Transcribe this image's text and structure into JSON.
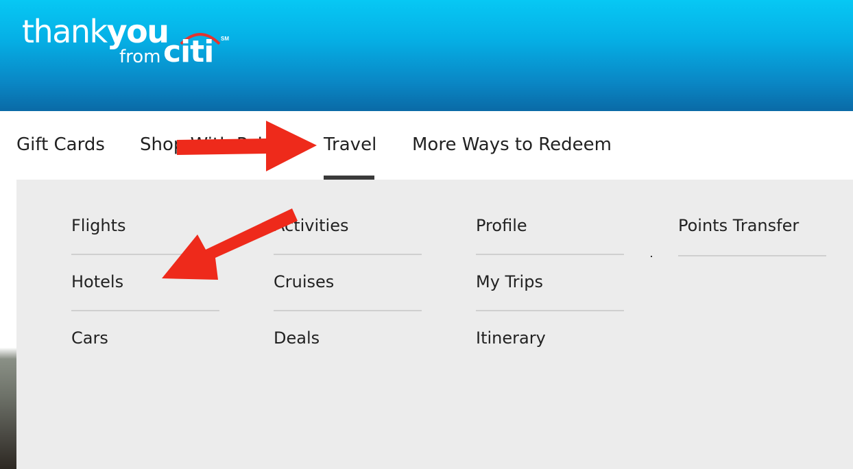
{
  "brand": {
    "thank": "thank",
    "you": "you",
    "from": "from",
    "citi": "citi",
    "sm": "SM",
    "header_colors": [
      "#07c8f4",
      "#0a6aa6"
    ]
  },
  "nav": {
    "items": [
      {
        "label": "Gift Cards"
      },
      {
        "label": "Shop With Points"
      },
      {
        "label": "Travel",
        "active": true
      },
      {
        "label": "More Ways to Redeem"
      }
    ]
  },
  "dropdown": {
    "columns": [
      {
        "links": [
          "Flights",
          "Hotels",
          "Cars"
        ]
      },
      {
        "links": [
          "Activities",
          "Cruises",
          "Deals"
        ]
      },
      {
        "links": [
          "Profile",
          "My Trips",
          "Itinerary"
        ]
      },
      {
        "links": [
          "Points Transfer"
        ]
      }
    ]
  },
  "annotations": {
    "arrow_color": "#ee2a1b",
    "arrows": [
      {
        "points_to": "Travel"
      },
      {
        "points_to": "Hotels"
      }
    ]
  }
}
